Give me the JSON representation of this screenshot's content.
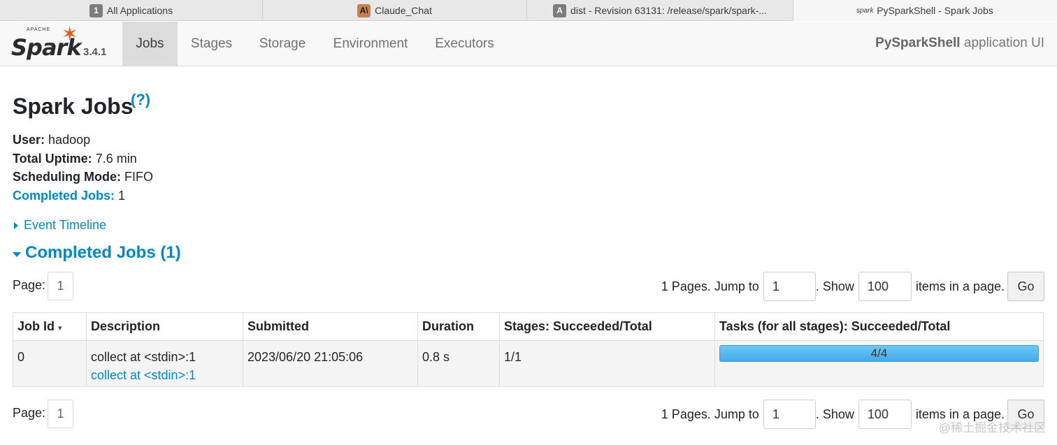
{
  "browser_tabs": [
    {
      "icon_text": "1",
      "title": "All Applications"
    },
    {
      "icon_text": "A\\",
      "title": "Claude_Chat"
    },
    {
      "icon_text": "A",
      "title": "dist - Revision 63131: /release/spark/spark-..."
    },
    {
      "icon_text": "spark",
      "title": "PySparkShell - Spark Jobs"
    }
  ],
  "navbar": {
    "brand_top": "APACHE",
    "brand": "Spark",
    "version": "3.4.1",
    "tabs": [
      "Jobs",
      "Stages",
      "Storage",
      "Environment",
      "Executors"
    ],
    "active_tab": "Jobs",
    "app_name": "PySparkShell",
    "app_suffix": "application UI"
  },
  "page": {
    "title": "Spark Jobs",
    "help": "(?)"
  },
  "summary": {
    "user_label": "User:",
    "user": "hadoop",
    "uptime_label": "Total Uptime:",
    "uptime": "7.6 min",
    "mode_label": "Scheduling Mode:",
    "mode": "FIFO",
    "completed_label": "Completed Jobs:",
    "completed": "1"
  },
  "event_timeline": "Event Timeline",
  "completed_section": "Completed Jobs (1)",
  "pagination": {
    "page_label": "Page:",
    "current_page": "1",
    "pages_text": "1 Pages. Jump to",
    "jump_value": "1",
    "show_text": ". Show",
    "show_value": "100",
    "items_text": "items in a page.",
    "go_label": "Go"
  },
  "table": {
    "headers": [
      "Job Id",
      "Description",
      "Submitted",
      "Duration",
      "Stages: Succeeded/Total",
      "Tasks (for all stages): Succeeded/Total"
    ],
    "sort_indicator": "▾",
    "rows": [
      {
        "job_id": "0",
        "description": "collect at <stdin>:1",
        "description_link": "collect at <stdin>:1",
        "submitted": "2023/06/20 21:05:06",
        "duration": "0.8 s",
        "stages": "1/1",
        "tasks": "4/4",
        "tasks_fraction": 1.0
      }
    ]
  },
  "watermark": "@稀土掘金技术社区",
  "colors": {
    "link": "#0088cc",
    "spark_orange": "#e25a1c",
    "progress": "#46a9ea"
  }
}
